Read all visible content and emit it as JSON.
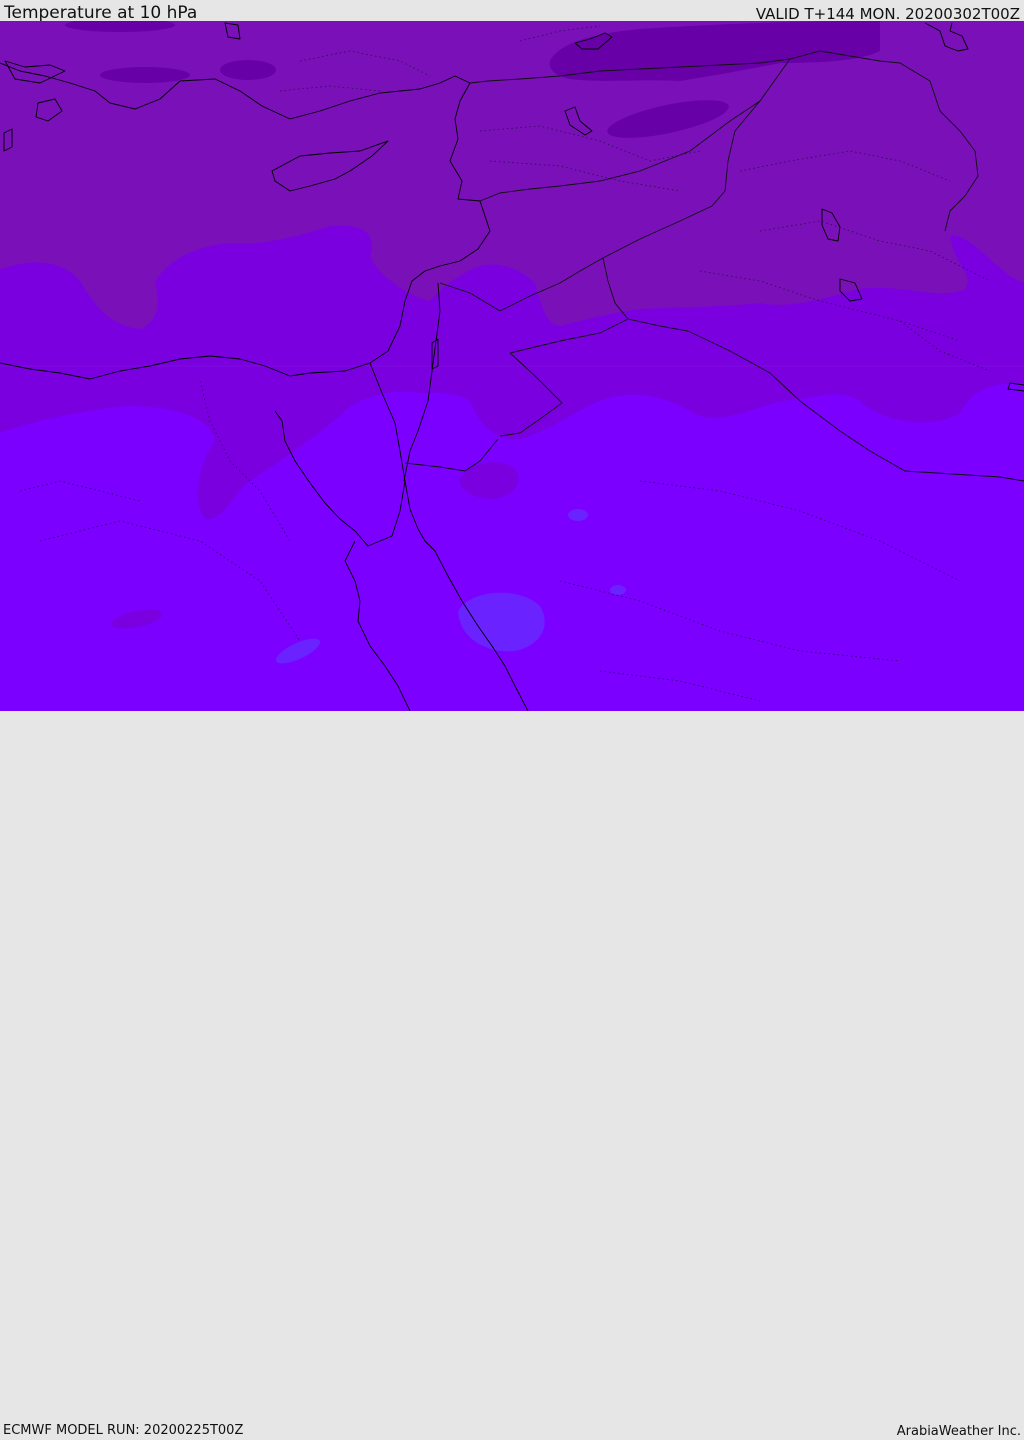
{
  "header": {
    "title": "Temperature at 10 hPa",
    "valid_time": "VALID T+144 MON. 20200302T00Z"
  },
  "footer": {
    "model_run": "ECMWF MODEL RUN: 20200225T00Z",
    "brand": "ArabiaWeather Inc."
  },
  "colors": {
    "temp_very_cold": "#6800a8",
    "temp_cold": "#7a10b8",
    "temp_mid": "#7a00e0",
    "temp_warm": "#7b00ff",
    "temp_warmest": "#6a22ff",
    "coastline": "#000000"
  }
}
